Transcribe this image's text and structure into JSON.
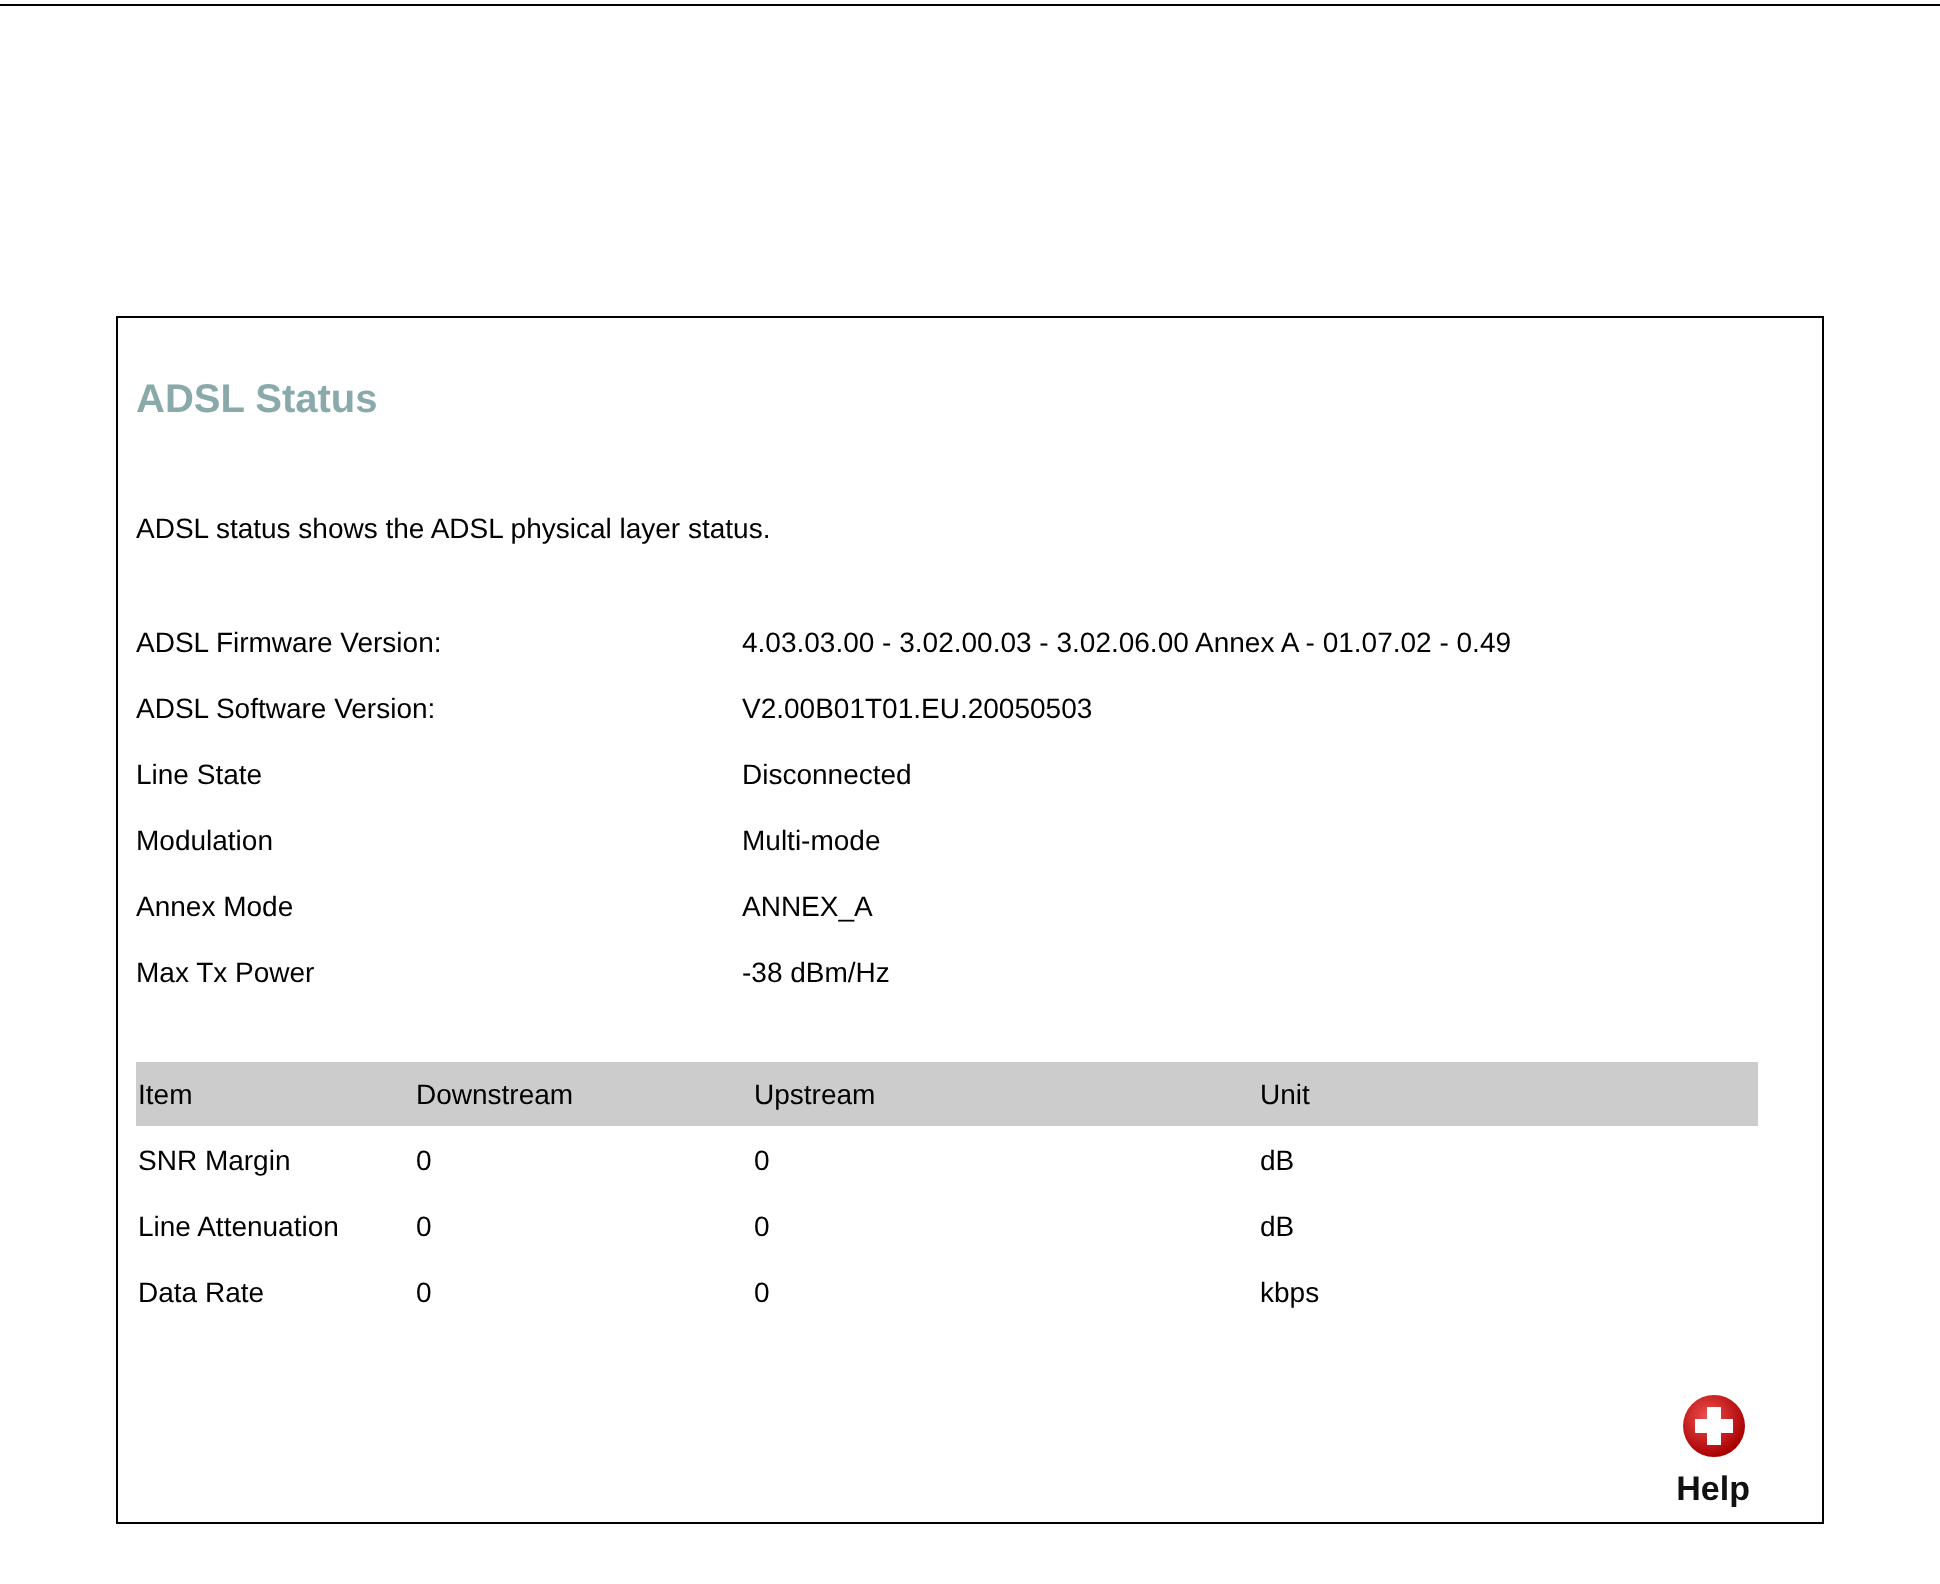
{
  "panel": {
    "title": "ADSL Status",
    "description": "ADSL status shows the ADSL physical layer status.",
    "info": [
      {
        "label": "ADSL Firmware Version:",
        "value": "4.03.03.00 - 3.02.00.03 - 3.02.06.00 Annex A - 01.07.02 - 0.49"
      },
      {
        "label": "ADSL Software Version:",
        "value": "V2.00B01T01.EU.20050503"
      },
      {
        "label": "Line State",
        "value": "Disconnected"
      },
      {
        "label": "Modulation",
        "value": "Multi-mode"
      },
      {
        "label": "Annex Mode",
        "value": "ANNEX_A"
      },
      {
        "label": "Max Tx Power",
        "value": "-38 dBm/Hz"
      }
    ],
    "table": {
      "columns": [
        "Item",
        "Downstream",
        "Upstream",
        "Unit"
      ],
      "rows": [
        [
          "SNR Margin",
          "0",
          "0",
          "dB"
        ],
        [
          "Line Attenuation",
          "0",
          "0",
          "dB"
        ],
        [
          "Data Rate",
          "0",
          "0",
          "kbps"
        ]
      ]
    },
    "help": {
      "label": "Help"
    }
  }
}
